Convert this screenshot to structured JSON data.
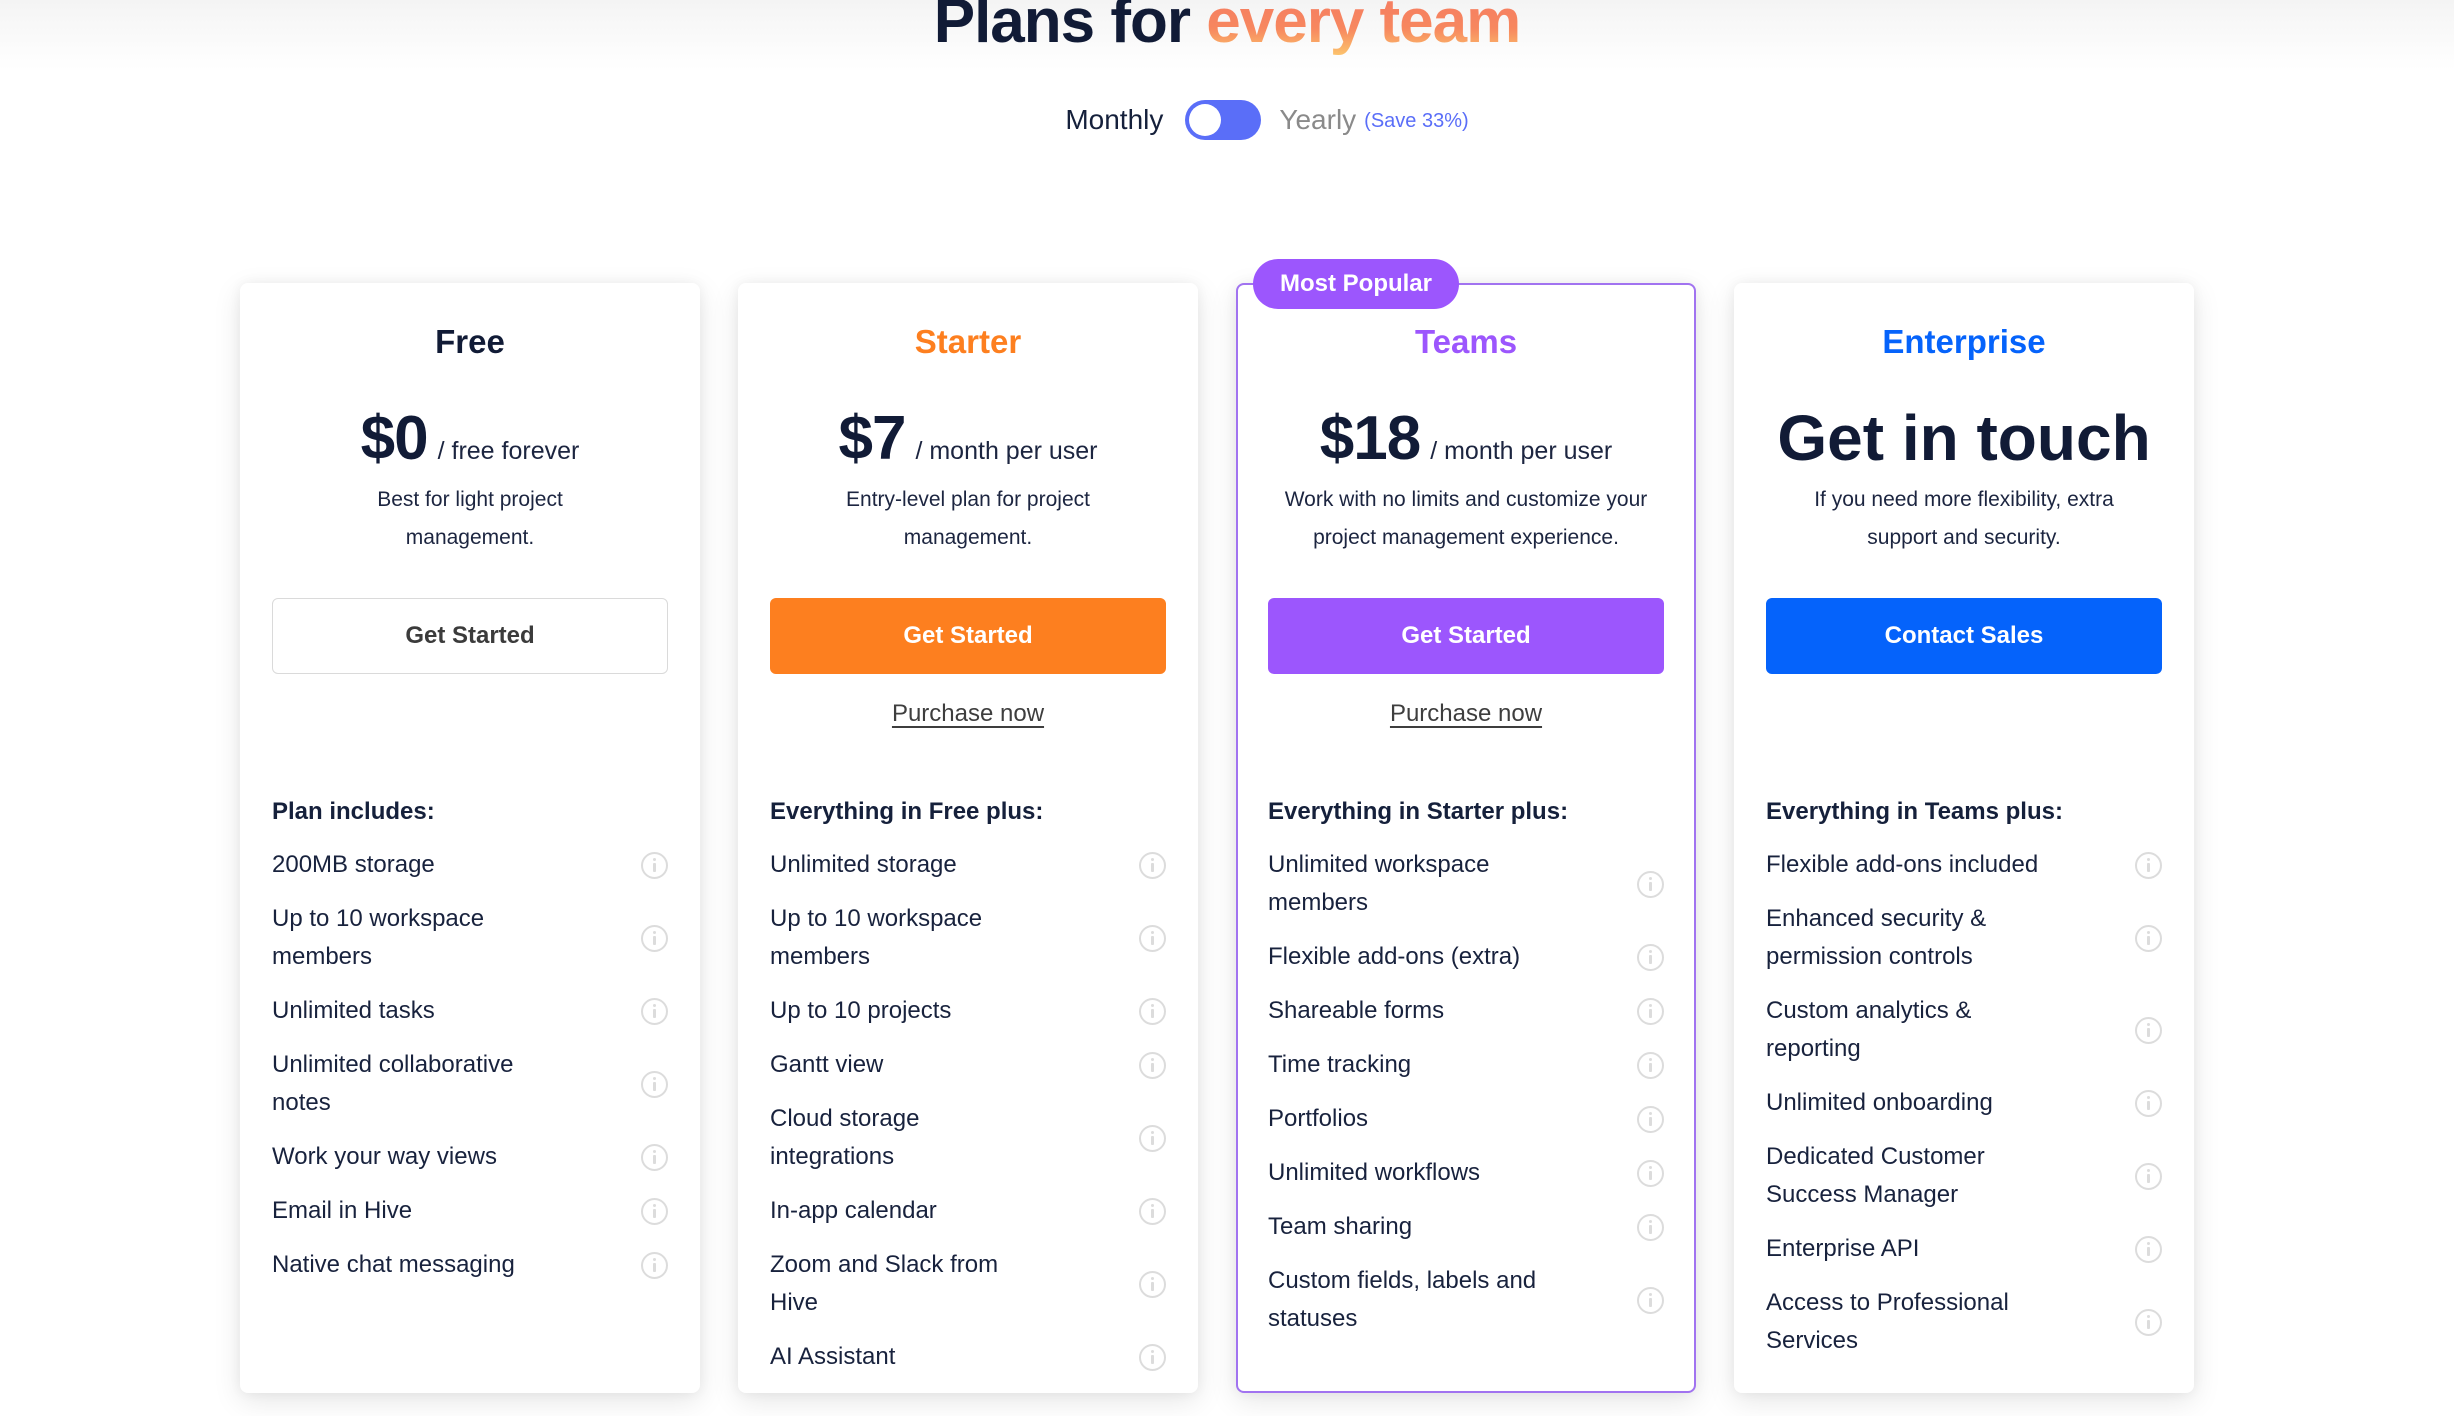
{
  "header": {
    "title_plain": "Plans for",
    "title_accent": "every team"
  },
  "billing": {
    "monthly_label": "Monthly",
    "yearly_label": "Yearly",
    "save_label": "(Save 33%)",
    "selected": "Monthly"
  },
  "colors": {
    "starter": "#fd7f1f",
    "teams": "#9c56fd",
    "enterprise": "#0563fb",
    "toggle": "#5a6ef8"
  },
  "plans": [
    {
      "name": "Free",
      "price": "$0",
      "period": "/ free forever",
      "description": "Best for light project management.",
      "cta": "Get Started",
      "features_title": "Plan includes:",
      "features": [
        "200MB storage",
        "Up to 10 workspace members",
        "Unlimited tasks",
        "Unlimited collaborative notes",
        "Work your way views",
        "Email in Hive",
        "Native chat messaging"
      ],
      "feature_icon": "info-icon"
    },
    {
      "name": "Starter",
      "price": "$7",
      "period": "/ month per user",
      "description": "Entry-level plan for project management.",
      "cta": "Get Started",
      "purchase_link": "Purchase now",
      "features_title": "Everything in Free plus:",
      "features": [
        "Unlimited storage",
        "Up to 10 workspace members",
        "Up to 10 projects",
        "Gantt view",
        "Cloud storage integrations",
        "In-app calendar",
        "Zoom and Slack from Hive",
        "AI Assistant"
      ],
      "feature_icon": "info-icon"
    },
    {
      "name": "Teams",
      "badge": "Most Popular",
      "price": "$18",
      "period": "/ month per user",
      "description": "Work with no limits and customize your project management experience.",
      "cta": "Get Started",
      "purchase_link": "Purchase now",
      "features_title": "Everything in Starter plus:",
      "features": [
        "Unlimited workspace members",
        "Flexible add-ons (extra)",
        "Shareable forms",
        "Time tracking",
        "Portfolios",
        "Unlimited workflows",
        "Team sharing",
        "Custom fields, labels and statuses"
      ],
      "feature_icon": "info-icon"
    },
    {
      "name": "Enterprise",
      "price": "Get in touch",
      "description": "If you need more flexibility, extra support and security.",
      "cta": "Contact Sales",
      "features_title": "Everything in Teams plus:",
      "features": [
        "Flexible add-ons included",
        "Enhanced security & permission controls",
        "Custom analytics & reporting",
        "Unlimited onboarding",
        "Dedicated Customer Success Manager",
        "Enterprise API",
        "Access to Professional Services"
      ],
      "feature_icon": "info-icon"
    }
  ]
}
